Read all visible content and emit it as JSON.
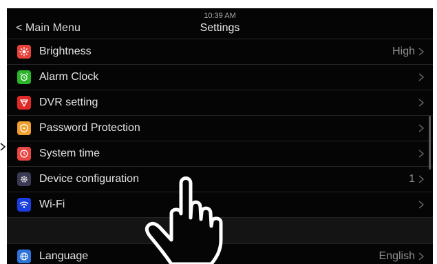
{
  "header": {
    "back_label": "< Main Menu",
    "time": "10:39 AM",
    "title": "Settings"
  },
  "items": [
    {
      "label": "Brightness",
      "value": "High",
      "icon": "brightness-icon",
      "color": "#e8413a"
    },
    {
      "label": "Alarm Clock",
      "value": "",
      "icon": "alarm-clock-icon",
      "color": "#2bb52b"
    },
    {
      "label": "DVR setting",
      "value": "",
      "icon": "dvr-icon",
      "color": "#e02a2a"
    },
    {
      "label": "Password Protection",
      "value": "",
      "icon": "shield-icon",
      "color": "#f0a030"
    },
    {
      "label": "System time",
      "value": "",
      "icon": "clock-icon",
      "color": "#e84545"
    },
    {
      "label": "Device configuration",
      "value": "1",
      "icon": "gear-icon",
      "color": "#3a3a55"
    },
    {
      "label": "Wi-Fi",
      "value": "",
      "icon": "wifi-icon",
      "color": "#1a3de0"
    }
  ],
  "language": {
    "label": "Language",
    "value": "English",
    "icon": "globe-icon",
    "color": "#2f72d8"
  },
  "overlay": {
    "icon": "tap-hand-icon"
  }
}
